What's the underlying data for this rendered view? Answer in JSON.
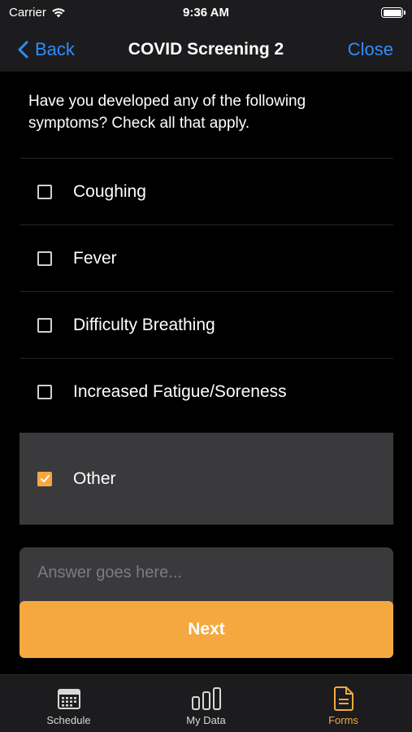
{
  "status_bar": {
    "carrier": "Carrier",
    "time": "9:36 AM"
  },
  "nav": {
    "back_label": "Back",
    "title": "COVID Screening 2",
    "close_label": "Close"
  },
  "question": "Have you developed any of the following symptoms? Check all that apply.",
  "options": [
    {
      "label": "Coughing",
      "checked": false
    },
    {
      "label": "Fever",
      "checked": false
    },
    {
      "label": "Difficulty Breathing",
      "checked": false
    },
    {
      "label": "Increased Fatigue/Soreness",
      "checked": false
    },
    {
      "label": "Other",
      "checked": true
    }
  ],
  "answer": {
    "placeholder": "Answer goes here...",
    "value": ""
  },
  "next_label": "Next",
  "tabs": [
    {
      "label": "Schedule",
      "icon": "calendar-icon",
      "active": false
    },
    {
      "label": "My Data",
      "icon": "bar-chart-icon",
      "active": false
    },
    {
      "label": "Forms",
      "icon": "document-icon",
      "active": true
    }
  ],
  "colors": {
    "accent": "#f5a840",
    "link": "#2f8cff",
    "background": "#000000",
    "bar_background": "#1c1c1e",
    "selected_row": "#3a3a3c"
  }
}
